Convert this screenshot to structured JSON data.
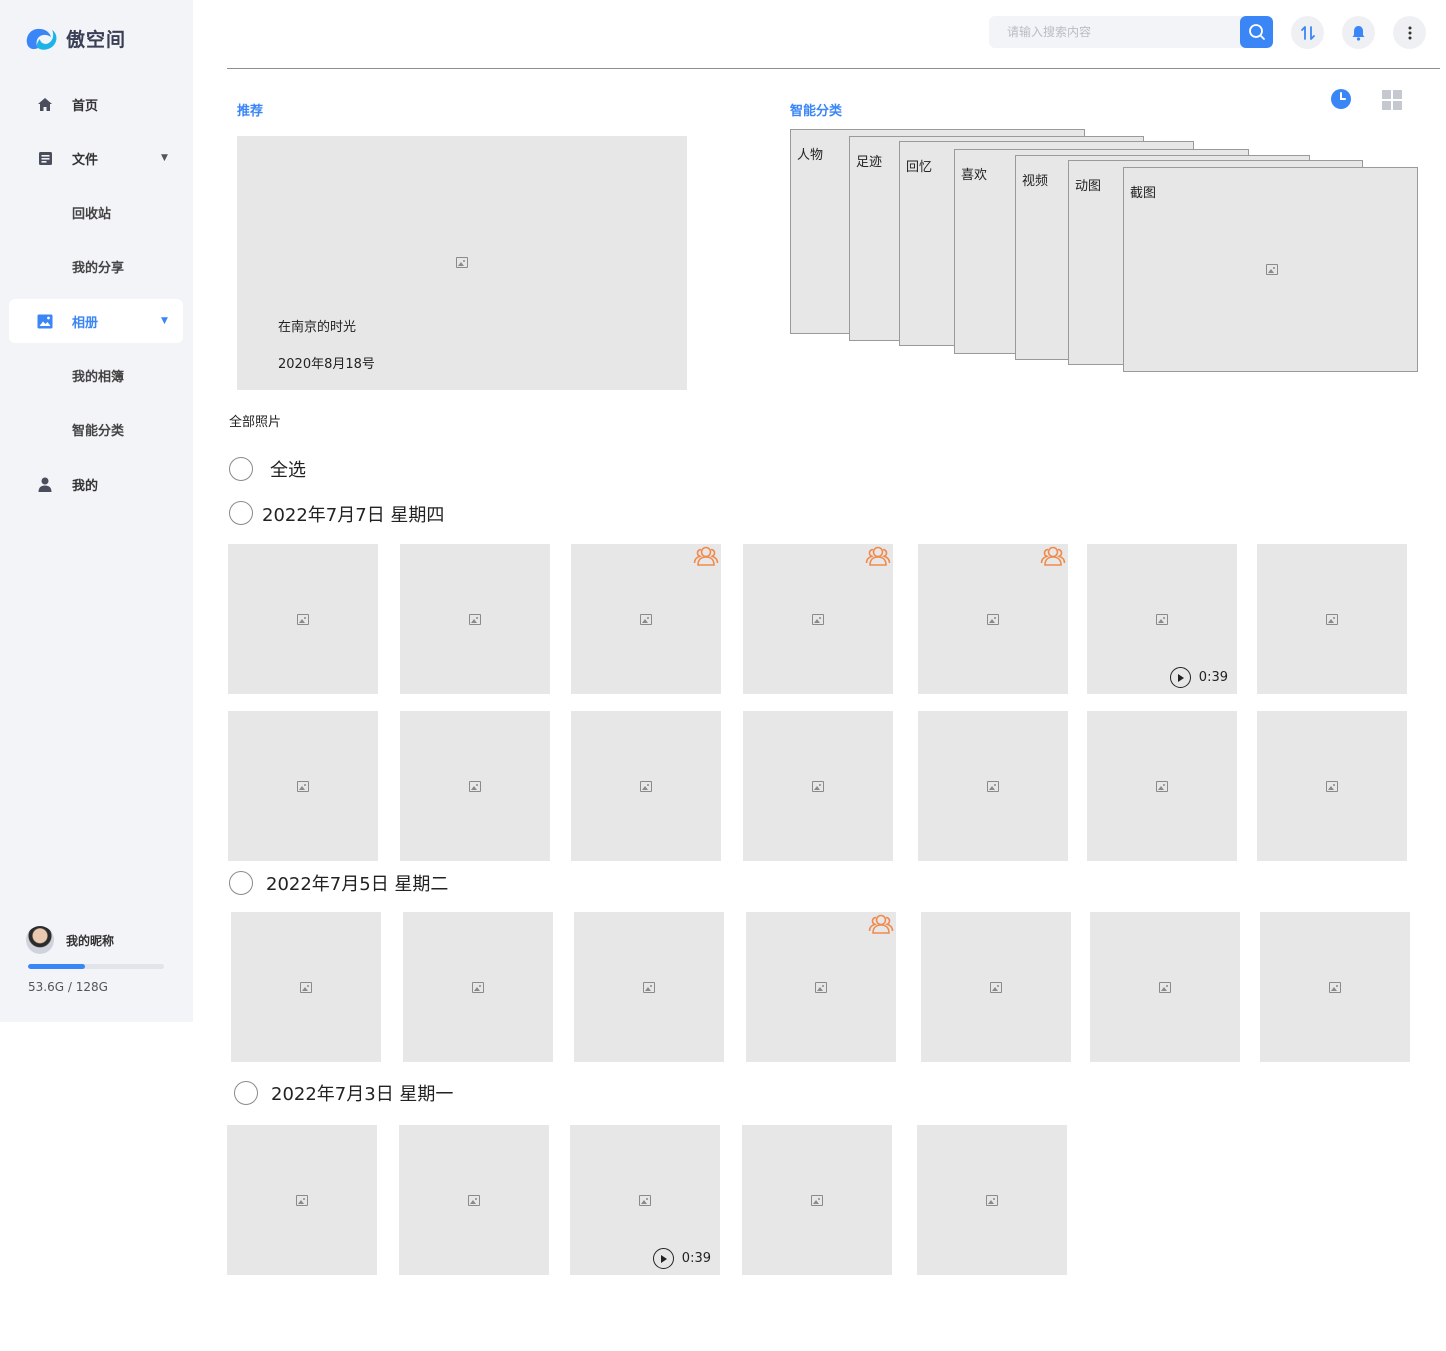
{
  "app": {
    "name": "傲空间"
  },
  "sidebar": {
    "items": [
      {
        "label": "首页",
        "icon": "home-icon"
      },
      {
        "label": "文件",
        "icon": "file-icon"
      },
      {
        "label": "回收站"
      },
      {
        "label": "我的分享"
      },
      {
        "label": "相册",
        "icon": "image-icon"
      },
      {
        "label": "我的相簿"
      },
      {
        "label": "智能分类"
      },
      {
        "label": "我的",
        "icon": "user-icon"
      }
    ],
    "profile": {
      "name": "我的昵称"
    },
    "storage": {
      "text": "53.6G / 128G",
      "used_gb": 53.6,
      "total_gb": 128
    }
  },
  "topbar": {
    "search_placeholder": "请输入搜索内容",
    "icons": [
      "search-icon",
      "transfer-icon",
      "bell-icon",
      "more-vertical-icon"
    ]
  },
  "recommend": {
    "title": "推荐",
    "card": {
      "title": "在南京的时光",
      "date": "2020年8月18号"
    }
  },
  "smart": {
    "title": "智能分类",
    "categories": [
      "人物",
      "足迹",
      "回忆",
      "喜欢",
      "视频",
      "动图",
      "截图"
    ]
  },
  "photos": {
    "title": "全部照片",
    "select_all": "全选",
    "groups": [
      {
        "date": "2022年7月7日  星期四"
      },
      {
        "date": "2022年7月5日  星期二"
      },
      {
        "date": "2022年7月3日  星期一"
      }
    ],
    "video_duration": "0:39"
  },
  "colors": {
    "accent": "#3b86f7",
    "people_badge": "#f08a4b",
    "placeholder": "#e7e7e7",
    "sidebar_bg": "#f3f4f8"
  }
}
